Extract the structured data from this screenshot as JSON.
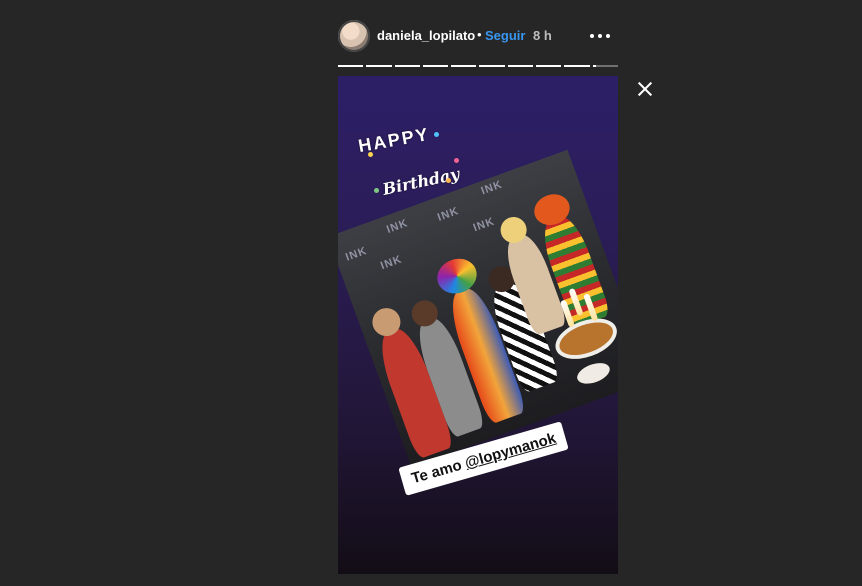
{
  "header": {
    "username": "daniela_lopilato",
    "separator": "•",
    "follow_label": "Seguir",
    "time": "8 h"
  },
  "story": {
    "segments": 10,
    "current_segment": 10,
    "current_progress": 0.15,
    "sticker_line1": "HAPPY",
    "sticker_line2": "Birthday",
    "photo_wall_text": [
      "INK",
      "INK",
      "INK",
      "INK",
      "INK",
      "INK"
    ],
    "caption_prefix": "Te amo ",
    "caption_mention": "@lopymanok"
  },
  "icons": {
    "more": "more-dots-icon",
    "close": "close-icon"
  },
  "colors": {
    "background": "#262626",
    "follow_link": "#3897f0"
  }
}
